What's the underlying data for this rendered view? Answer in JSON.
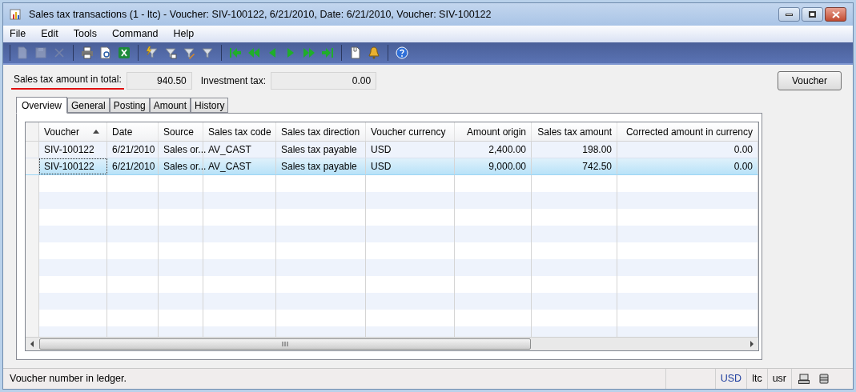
{
  "window": {
    "title": "Sales tax transactions (1 - ltc) - Voucher: SIV-100122, 6/21/2010, Date: 6/21/2010, Voucher: SIV-100122"
  },
  "menu": [
    "File",
    "Edit",
    "Tools",
    "Command",
    "Help"
  ],
  "toolbar": [
    [
      {
        "kind": "new",
        "disabled": true
      },
      {
        "kind": "save",
        "disabled": true
      },
      {
        "kind": "delete",
        "disabled": true
      }
    ],
    [
      {
        "kind": "print",
        "disabled": false
      },
      {
        "kind": "preview",
        "disabled": false
      },
      {
        "kind": "excel",
        "disabled": false
      }
    ],
    [
      {
        "kind": "filter-bolt",
        "disabled": false
      },
      {
        "kind": "filter-grid",
        "disabled": false
      },
      {
        "kind": "filter-pencil",
        "disabled": false
      },
      {
        "kind": "filter",
        "disabled": false
      }
    ],
    [
      {
        "kind": "first",
        "disabled": false
      },
      {
        "kind": "prev-page",
        "disabled": false
      },
      {
        "kind": "prev",
        "disabled": false
      },
      {
        "kind": "next",
        "disabled": false
      },
      {
        "kind": "next-page",
        "disabled": false
      },
      {
        "kind": "last",
        "disabled": false
      }
    ],
    [
      {
        "kind": "document",
        "disabled": false
      },
      {
        "kind": "alert",
        "disabled": false
      }
    ],
    [
      {
        "kind": "help",
        "disabled": false
      }
    ]
  ],
  "fields": [
    {
      "label": "Sales tax amount in total:",
      "value": "940.50",
      "underlined": true
    },
    {
      "label": "Investment tax:",
      "value": "0.00",
      "underlined": false
    }
  ],
  "buttons": [
    "Voucher"
  ],
  "tabs": [
    {
      "label": "Overview",
      "selected": true
    },
    {
      "label": "General",
      "selected": false
    },
    {
      "label": "Posting",
      "selected": false
    },
    {
      "label": "Amount",
      "selected": false
    },
    {
      "label": "History",
      "selected": false
    }
  ],
  "table": {
    "columns": [
      {
        "label": "Voucher",
        "sorted": true
      },
      {
        "label": "Date",
        "sorted": false
      },
      {
        "label": "Source",
        "sorted": false
      },
      {
        "label": "Sales tax code",
        "sorted": false
      },
      {
        "label": "Sales tax direction",
        "sorted": false
      },
      {
        "label": "Voucher currency",
        "sorted": false
      },
      {
        "label": "Amount origin",
        "sorted": false
      },
      {
        "label": "Sales tax amount",
        "sorted": false
      },
      {
        "label": "Corrected amount in currency",
        "sorted": false
      }
    ],
    "rows": [
      {
        "selected": false,
        "cells": [
          "SIV-100122",
          "6/21/2010",
          "Sales or...",
          "AV_CAST",
          "Sales tax payable",
          "USD",
          "2,400.00",
          "198.00",
          "0.00"
        ]
      },
      {
        "selected": true,
        "cells": [
          "SIV-100122",
          "6/21/2010",
          "Sales or...",
          "AV_CAST",
          "Sales tax payable",
          "USD",
          "9,000.00",
          "742.50",
          "0.00"
        ]
      }
    ]
  },
  "status_bar": {
    "message": "Voucher number in ledger.",
    "cells": [
      {
        "text": "USD",
        "color": "#1f3f9f"
      },
      {
        "text": "ltc"
      },
      {
        "text": "usr"
      }
    ]
  }
}
